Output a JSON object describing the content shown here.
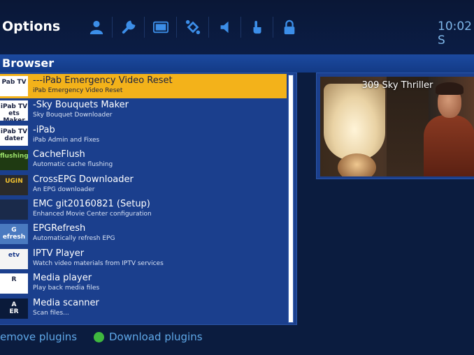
{
  "header": {
    "title": "Options",
    "clock": "10:02 S",
    "toolbar": [
      {
        "icon": "user-icon"
      },
      {
        "icon": "wrench-icon"
      },
      {
        "icon": "screen-icon"
      },
      {
        "icon": "satellite-icon"
      },
      {
        "icon": "speaker-icon"
      },
      {
        "icon": "hand-pointer-icon"
      },
      {
        "icon": "lock-icon"
      }
    ]
  },
  "section": {
    "title": "Browser"
  },
  "plugins": [
    {
      "thumb": "Pab TV",
      "title": "---iPab Emergency Video Reset",
      "desc": "iPab Emergency Video Reset",
      "selected": true
    },
    {
      "thumb": "iPab TV\nets Maker",
      "title": "-Sky Bouquets Maker",
      "desc": "Sky Bouquet Downloader",
      "selected": false
    },
    {
      "thumb": "iPab TV\ndater",
      "title": "-iPab",
      "desc": "iPab Admin and Fixes",
      "selected": false
    },
    {
      "thumb": "flushing",
      "title": "CacheFlush",
      "desc": "Automatic cache flushing",
      "selected": false
    },
    {
      "thumb": "UGIN",
      "title": "CrossEPG Downloader",
      "desc": "An EPG downloader",
      "selected": false
    },
    {
      "thumb": "",
      "title": "EMC git20160821 (Setup)",
      "desc": "Enhanced Movie Center configuration",
      "selected": false
    },
    {
      "thumb": "G\nefresh",
      "title": "EPGRefresh",
      "desc": "Automatically refresh EPG",
      "selected": false
    },
    {
      "thumb": "etv",
      "title": "IPTV Player",
      "desc": "Watch video materials from IPTV services",
      "selected": false
    },
    {
      "thumb": "R",
      "title": "Media player",
      "desc": "Play back media files",
      "selected": false
    },
    {
      "thumb": "A\nER",
      "title": "Media scanner",
      "desc": "Scan files...",
      "selected": false
    }
  ],
  "preview": {
    "title": "309 Sky Thriller"
  },
  "footer": {
    "remove_label": "emove plugins",
    "download_label": "Download plugins",
    "download_color": "#3fb83f"
  },
  "colors": {
    "background": "#0b1c3f",
    "panel": "#1b3f8d",
    "selection": "#f3b21a",
    "accent": "#5fa8e8"
  }
}
